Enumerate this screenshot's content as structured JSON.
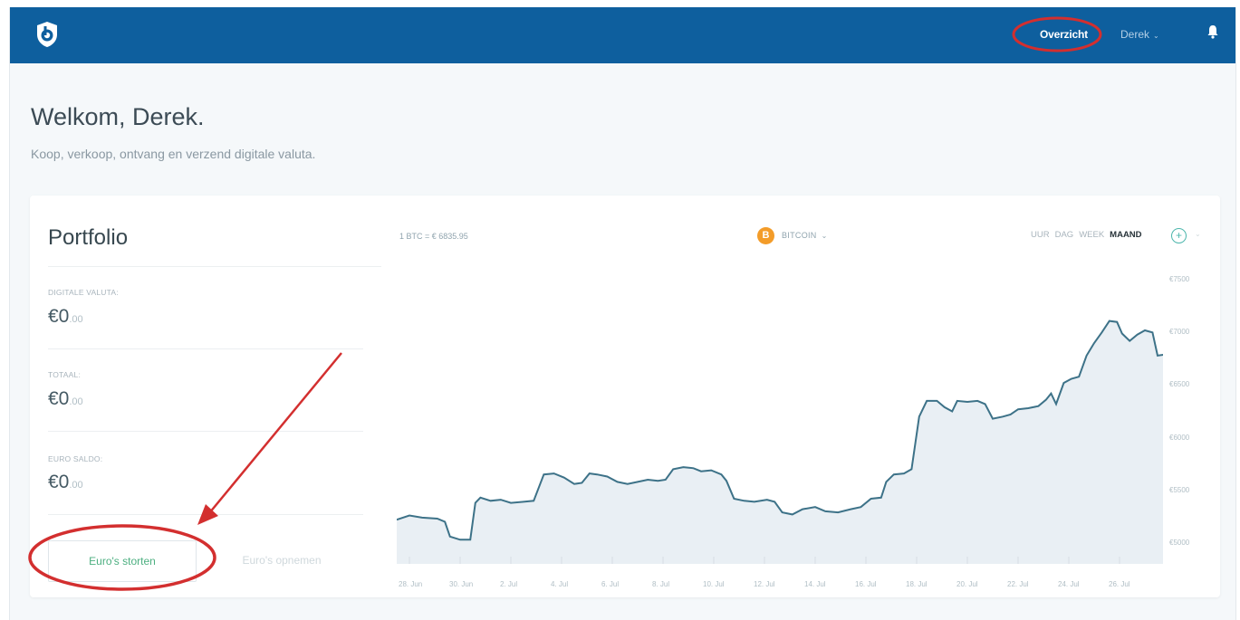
{
  "header": {
    "nav_overview": "Overzicht",
    "nav_user": "Derek",
    "brand_color": "#0e5f9e",
    "logo_icon": "shield-b-icon",
    "bell_icon": "bell-icon"
  },
  "welcome": {
    "title": "Welkom, Derek.",
    "subtitle": "Koop, verkoop, ontvang en verzend digitale valuta."
  },
  "portfolio": {
    "title": "Portfolio",
    "stats": [
      {
        "label": "DIGITALE VALUTA:",
        "value": "€0",
        "decimals": ".00"
      },
      {
        "label": "TOTAAL:",
        "value": "€0",
        "decimals": ".00"
      },
      {
        "label": "EURO SALDO:",
        "value": "€0",
        "decimals": ".00"
      }
    ],
    "deposit_label": "Euro's storten",
    "withdraw_label": "Euro's opnemen"
  },
  "chart_header": {
    "price": "1 BTC = € 6835.95",
    "coin": "BITCOIN",
    "coin_symbol": "B",
    "coin_color": "#f39c29",
    "ranges": [
      "UUR",
      "DAG",
      "WEEK",
      "MAAND"
    ],
    "active_range": "MAAND"
  },
  "chart_data": {
    "type": "area",
    "title": "",
    "xlabel": "",
    "ylabel": "",
    "y_tick_labels": [
      "€7500",
      "€7000",
      "€6500",
      "€6000",
      "€5500",
      "€5000"
    ],
    "y_ticks": [
      7500,
      7000,
      6500,
      6000,
      5500,
      5000
    ],
    "ylim": [
      4800,
      7700
    ],
    "x_tick_labels": [
      "28. Jun",
      "30. Jun",
      "2. Jul",
      "4. Jul",
      "6. Jul",
      "8. Jul",
      "10. Jul",
      "12. Jul",
      "14. Jul",
      "16. Jul",
      "18. Jul",
      "20. Jul",
      "22. Jul",
      "24. Jul",
      "26. Jul"
    ],
    "x_start_day": 0,
    "x_end_day": 30,
    "grid": false,
    "line_color": "#3d7288",
    "fill_color": "#e9eff4",
    "points": [
      [
        0,
        5220
      ],
      [
        0.5,
        5260
      ],
      [
        1.0,
        5240
      ],
      [
        1.6,
        5230
      ],
      [
        1.9,
        5200
      ],
      [
        2.1,
        5060
      ],
      [
        2.5,
        5030
      ],
      [
        2.9,
        5030
      ],
      [
        3.1,
        5380
      ],
      [
        3.3,
        5430
      ],
      [
        3.7,
        5400
      ],
      [
        4.1,
        5410
      ],
      [
        4.5,
        5380
      ],
      [
        5.0,
        5390
      ],
      [
        5.4,
        5400
      ],
      [
        5.8,
        5650
      ],
      [
        6.2,
        5660
      ],
      [
        6.6,
        5620
      ],
      [
        7.0,
        5560
      ],
      [
        7.3,
        5570
      ],
      [
        7.6,
        5660
      ],
      [
        7.9,
        5650
      ],
      [
        8.3,
        5630
      ],
      [
        8.7,
        5580
      ],
      [
        9.1,
        5560
      ],
      [
        9.5,
        5580
      ],
      [
        9.9,
        5600
      ],
      [
        10.3,
        5590
      ],
      [
        10.6,
        5600
      ],
      [
        10.9,
        5700
      ],
      [
        11.3,
        5720
      ],
      [
        11.7,
        5710
      ],
      [
        12.0,
        5680
      ],
      [
        12.4,
        5690
      ],
      [
        12.8,
        5650
      ],
      [
        13.0,
        5590
      ],
      [
        13.3,
        5420
      ],
      [
        13.7,
        5400
      ],
      [
        14.1,
        5390
      ],
      [
        14.6,
        5410
      ],
      [
        14.9,
        5390
      ],
      [
        15.2,
        5290
      ],
      [
        15.6,
        5270
      ],
      [
        16.0,
        5320
      ],
      [
        16.5,
        5340
      ],
      [
        16.9,
        5300
      ],
      [
        17.4,
        5290
      ],
      [
        17.9,
        5320
      ],
      [
        18.3,
        5340
      ],
      [
        18.7,
        5420
      ],
      [
        19.1,
        5430
      ],
      [
        19.3,
        5580
      ],
      [
        19.6,
        5650
      ],
      [
        20.0,
        5660
      ],
      [
        20.3,
        5700
      ],
      [
        20.6,
        6200
      ],
      [
        20.9,
        6350
      ],
      [
        21.3,
        6350
      ],
      [
        21.6,
        6290
      ],
      [
        21.9,
        6250
      ],
      [
        22.1,
        6350
      ],
      [
        22.5,
        6340
      ],
      [
        22.9,
        6350
      ],
      [
        23.2,
        6320
      ],
      [
        23.5,
        6180
      ],
      [
        23.9,
        6200
      ],
      [
        24.2,
        6220
      ],
      [
        24.5,
        6270
      ],
      [
        24.9,
        6280
      ],
      [
        25.3,
        6300
      ],
      [
        25.6,
        6360
      ],
      [
        25.8,
        6420
      ],
      [
        26.0,
        6320
      ],
      [
        26.3,
        6520
      ],
      [
        26.6,
        6560
      ],
      [
        26.9,
        6580
      ],
      [
        27.2,
        6780
      ],
      [
        27.5,
        6900
      ],
      [
        27.8,
        7000
      ],
      [
        28.1,
        7110
      ],
      [
        28.4,
        7100
      ],
      [
        28.6,
        6990
      ],
      [
        28.9,
        6920
      ],
      [
        29.2,
        6980
      ],
      [
        29.5,
        7020
      ],
      [
        29.8,
        7000
      ],
      [
        30.0,
        6780
      ],
      [
        30.3,
        6790
      ],
      [
        30.6,
        6830
      ]
    ]
  }
}
